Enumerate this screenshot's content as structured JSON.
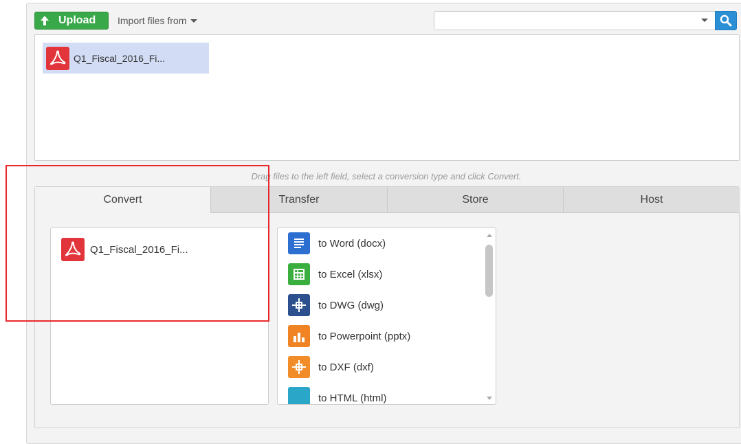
{
  "toolbar": {
    "upload_label": "Upload",
    "import_label": "Import files from",
    "search": {
      "value": "",
      "placeholder": ""
    }
  },
  "files": [
    {
      "name": "Q1_Fiscal_2016_Fi..."
    }
  ],
  "hint": "Drag files to the left field, select a conversion type and click Convert.",
  "tabs": [
    {
      "label": "Convert",
      "active": true
    },
    {
      "label": "Transfer",
      "active": false
    },
    {
      "label": "Store",
      "active": false
    },
    {
      "label": "Host",
      "active": false
    }
  ],
  "convert": {
    "selected_file": "Q1_Fiscal_2016_Fi...",
    "options": [
      {
        "label": "to Word (docx)",
        "icon": "word-doc-icon",
        "color": "#2c6fd1"
      },
      {
        "label": "to Excel (xlsx)",
        "icon": "excel-sheet-icon",
        "color": "#3aae3e"
      },
      {
        "label": "to DWG (dwg)",
        "icon": "dwg-cad-icon",
        "color": "#2c4f8e"
      },
      {
        "label": "to Powerpoint (pptx)",
        "icon": "powerpoint-icon",
        "color": "#f08323"
      },
      {
        "label": "to DXF (dxf)",
        "icon": "dxf-cad-icon",
        "color": "#f28c28"
      },
      {
        "label": "to HTML (html)",
        "icon": "html-icon",
        "color": "#2aa7c8"
      }
    ]
  },
  "colors": {
    "upload_green": "#39a849",
    "search_blue": "#2b8fd6",
    "selection_blue": "#d2ddf5",
    "pdf_red": "#e2343b",
    "highlight_red": "#e8272d"
  }
}
